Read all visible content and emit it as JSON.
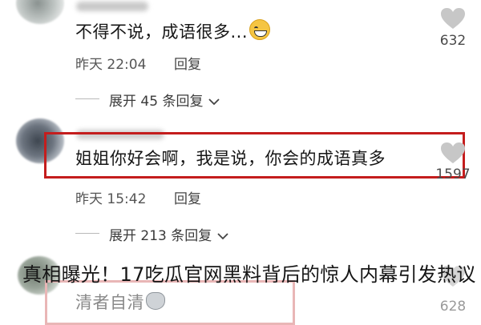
{
  "comments": [
    {
      "text": "不得不说，成语很多...",
      "emoji": "grinning-sweat-emoji",
      "time": "昨天 22:04",
      "reply_label": "回复",
      "likes": "632",
      "expand_label": "展开 45 条回复"
    },
    {
      "text": "姐姐你好会啊，我是说，你会的成语真多",
      "time": "昨天 15:42",
      "reply_label": "回复",
      "likes": "1597",
      "expand_label": "展开 213 条回复"
    },
    {
      "text": "清者自清",
      "emoji": "cat-emoji",
      "likes": "628"
    }
  ],
  "caption": "真相曝光！17吃瓜官网黑料背后的惊人内幕引发热议",
  "colors": {
    "highlight": "#c41d1d",
    "text": "#161616",
    "meta": "#555555"
  }
}
